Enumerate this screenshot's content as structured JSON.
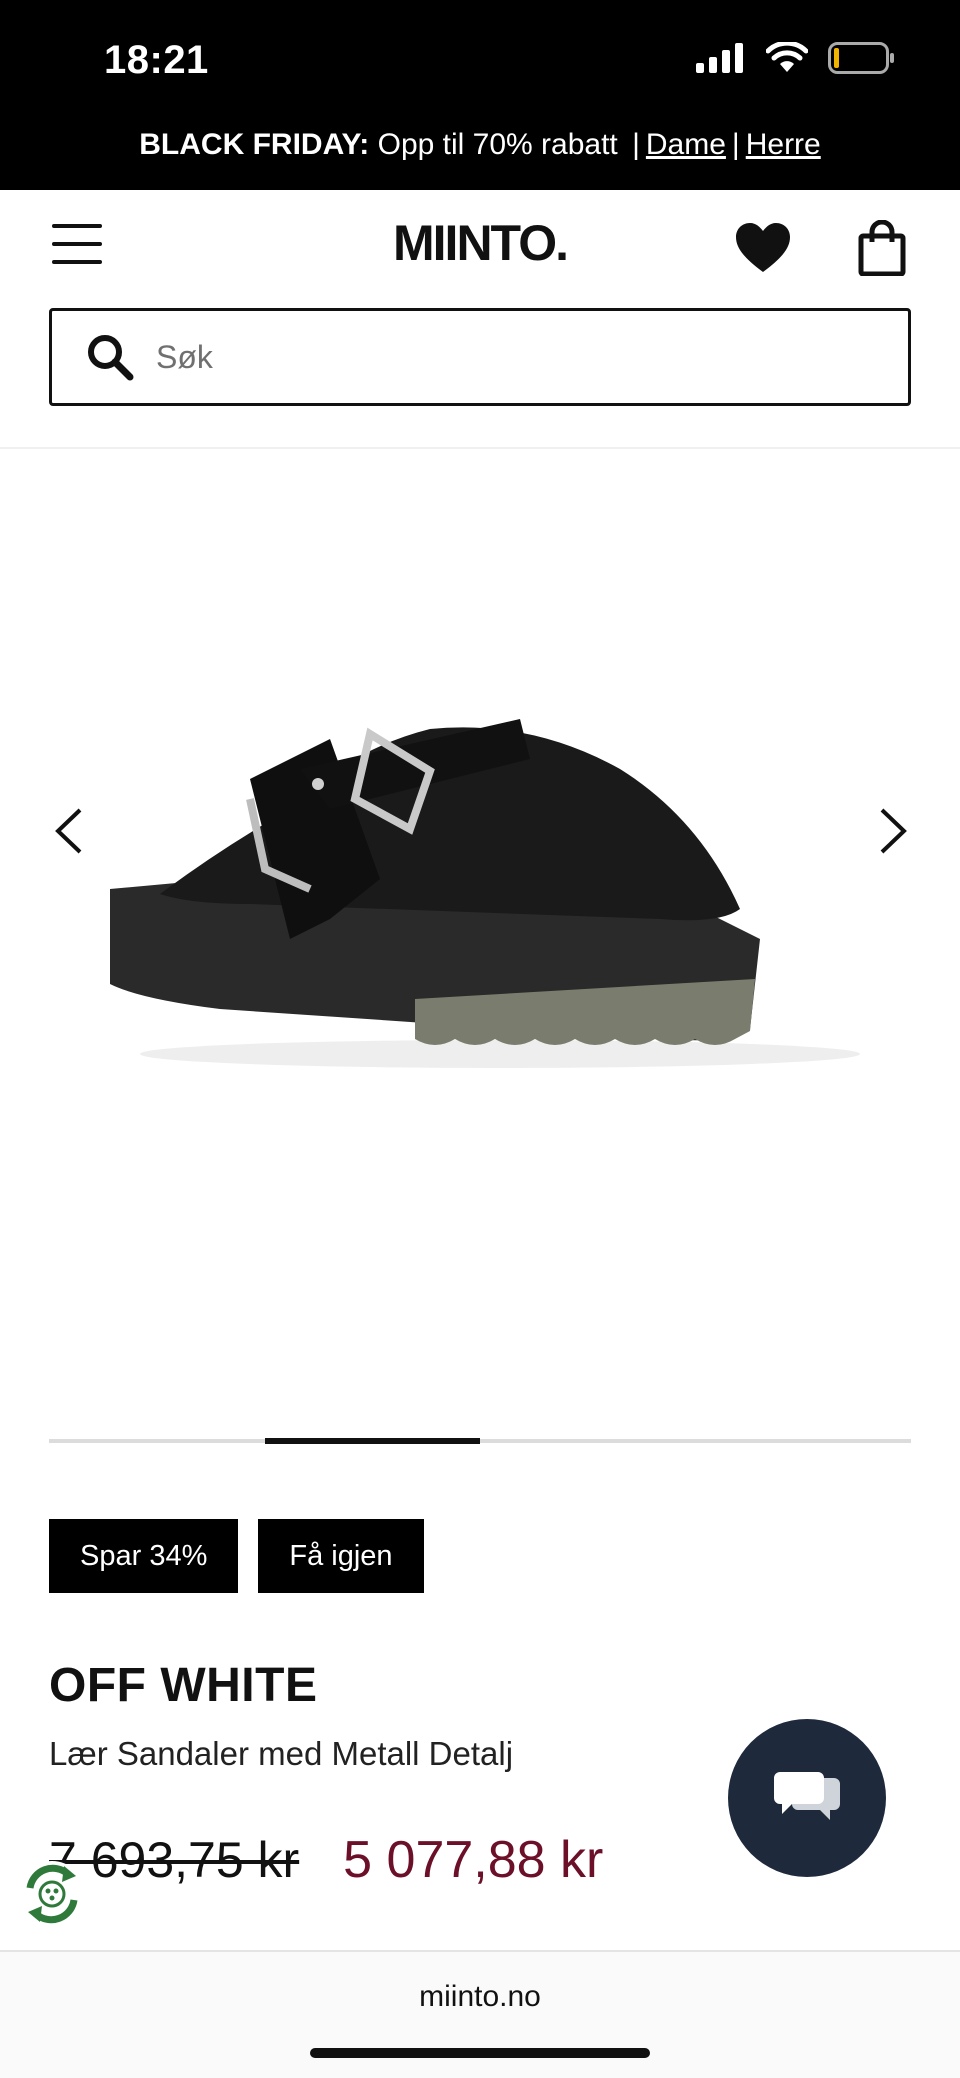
{
  "status_bar": {
    "time": "18:21",
    "icons": [
      "signal-icon",
      "wifi-icon",
      "battery-icon"
    ]
  },
  "promo": {
    "label": "BLACK FRIDAY:",
    "text": "Opp til 70% rabatt",
    "separator": "|",
    "link_women": "Dame",
    "link_men": "Herre"
  },
  "header": {
    "logo": "MIINTO.",
    "icons": [
      "menu-icon",
      "heart-icon",
      "shopping-bag-icon"
    ]
  },
  "search": {
    "placeholder": "Søk",
    "value": ""
  },
  "gallery": {
    "image": "black suede clog with silver buckle",
    "progress": {
      "segments": 4,
      "active_index": 1
    }
  },
  "badges": {
    "discount": "Spar 34%",
    "restock": "Få igjen"
  },
  "product": {
    "brand": "OFF WHITE",
    "name": "Lær Sandaler med Metall Detalj",
    "old_price": "7 693,75 kr",
    "new_price": "5 077,88 kr"
  },
  "colors": {
    "sale_price": "#6b1028",
    "chat_button": "#1e2a3c",
    "eco_green": "#2f7a3a"
  },
  "browser": {
    "url": "miinto.no"
  }
}
